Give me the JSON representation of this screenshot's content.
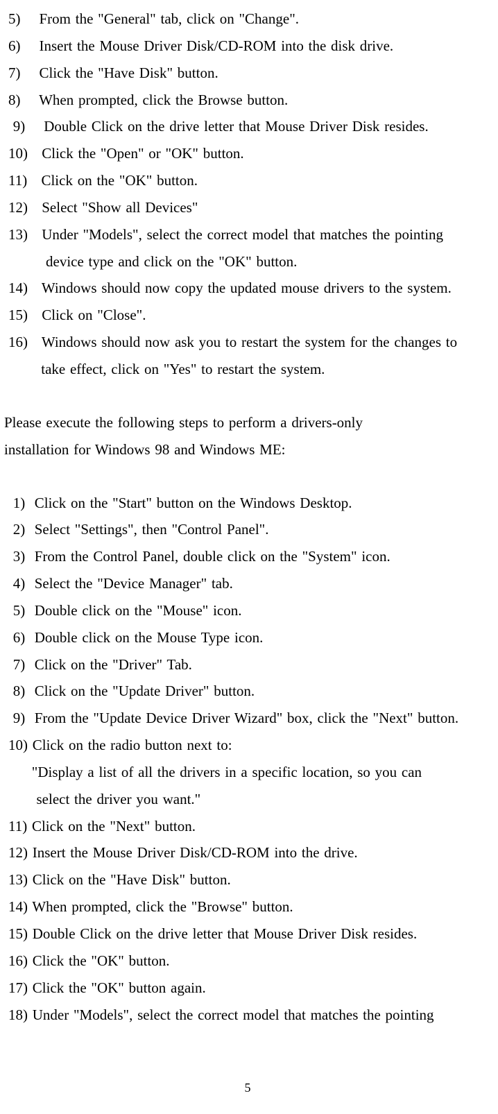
{
  "section1": {
    "items": [
      "5)    From the \"General\" tab, click on \"Change\".",
      "6)    Insert the Mouse Driver Disk/CD-ROM into the disk drive.",
      "7)    Click the \"Have Disk\" button.",
      "8)    When prompted, click the Browse button.",
      " 9)    Double Click on the drive letter that Mouse Driver Disk resides.",
      "10)   Click the \"Open\" or \"OK\" button.",
      "11)   Click on the \"OK\" button.",
      "12)   Select \"Show all Devices\"",
      "13)   Under \"Models\", select the correct model that matches the pointing",
      "        device type and click on the \"OK\" button.",
      "14)   Windows should now copy the updated mouse drivers to the system.",
      "15)   Click on \"Close\".",
      "16)   Windows should now ask you to restart the system for the changes to",
      "       take effect, click on \"Yes\" to restart the system."
    ]
  },
  "intro": {
    "line1": "Please execute the following steps to perform a drivers-only",
    "line2": "installation for Windows 98 and Windows ME:"
  },
  "section2": {
    "items": [
      " 1)  Click on the \"Start\" button on the Windows Desktop.",
      " 2)  Select \"Settings\", then \"Control Panel\".",
      " 3)  From the Control Panel, double click on the \"System\" icon.",
      " 4)  Select the \"Device Manager\" tab.",
      " 5)  Double click on the \"Mouse\" icon.",
      " 6)  Double click on the Mouse Type icon.",
      " 7)  Click on the \"Driver\" Tab.",
      " 8)  Click on the \"Update Driver\" button.",
      " 9)  From the \"Update Device Driver Wizard\" box, click the \"Next\" button.",
      "10) Click on the radio button next to:",
      "     \"Display a list of all the drivers in a specific location, so you can",
      "      select the driver you want.\"",
      "11) Click on the \"Next\" button.",
      "12) Insert the Mouse Driver Disk/CD-ROM into the drive.",
      "13) Click on the \"Have Disk\" button.",
      "14) When prompted, click the \"Browse\" button.",
      "15) Double Click on the drive letter that Mouse Driver Disk resides.",
      "16) Click the \"OK\" button.",
      "17) Click the \"OK\" button again.",
      "18) Under \"Models\", select the correct model that matches the pointing"
    ]
  },
  "pageNumber": "5"
}
